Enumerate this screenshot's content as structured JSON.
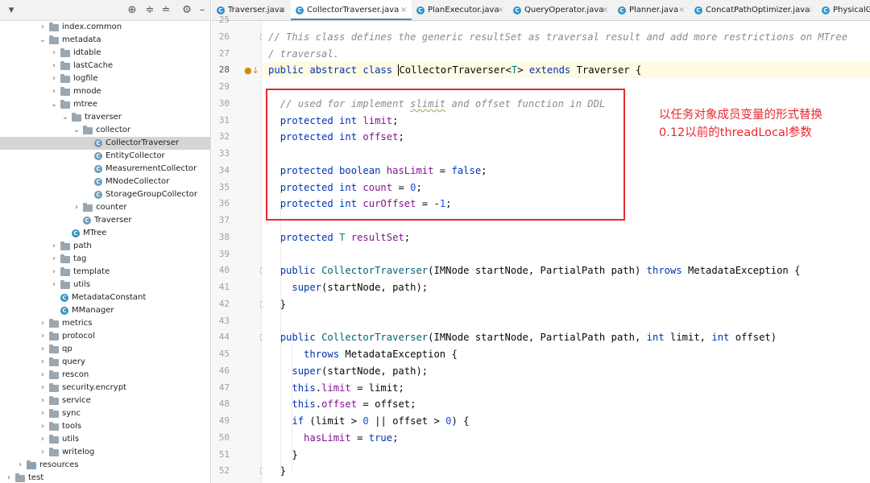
{
  "tree": {
    "header_icons": [
      "globe-icon",
      "expand-icon",
      "collapse-icon",
      "gear-icon",
      "minimize-icon"
    ],
    "rows": [
      {
        "label": "index.common",
        "indent": 3,
        "kind": "folder",
        "expanded": false
      },
      {
        "label": "metadata",
        "indent": 3,
        "kind": "folder",
        "expanded": true
      },
      {
        "label": "idtable",
        "indent": 4,
        "kind": "folder",
        "expanded": false
      },
      {
        "label": "lastCache",
        "indent": 4,
        "kind": "folder",
        "expanded": false
      },
      {
        "label": "logfile",
        "indent": 4,
        "kind": "folder",
        "expanded": false
      },
      {
        "label": "mnode",
        "indent": 4,
        "kind": "folder",
        "expanded": false
      },
      {
        "label": "mtree",
        "indent": 4,
        "kind": "folder",
        "expanded": true
      },
      {
        "label": "traverser",
        "indent": 5,
        "kind": "folder",
        "expanded": true
      },
      {
        "label": "collector",
        "indent": 6,
        "kind": "folder",
        "expanded": true
      },
      {
        "label": "CollectorTraverser",
        "indent": 7,
        "kind": "abstract-class",
        "selected": true
      },
      {
        "label": "EntityCollector",
        "indent": 7,
        "kind": "abstract-class"
      },
      {
        "label": "MeasurementCollector",
        "indent": 7,
        "kind": "abstract-class"
      },
      {
        "label": "MNodeCollector",
        "indent": 7,
        "kind": "abstract-class"
      },
      {
        "label": "StorageGroupCollector",
        "indent": 7,
        "kind": "abstract-class"
      },
      {
        "label": "counter",
        "indent": 6,
        "kind": "folder",
        "expanded": false
      },
      {
        "label": "Traverser",
        "indent": 6,
        "kind": "abstract-class"
      },
      {
        "label": "MTree",
        "indent": 5,
        "kind": "class"
      },
      {
        "label": "path",
        "indent": 4,
        "kind": "folder",
        "expanded": false
      },
      {
        "label": "tag",
        "indent": 4,
        "kind": "folder",
        "expanded": false
      },
      {
        "label": "template",
        "indent": 4,
        "kind": "folder",
        "expanded": false
      },
      {
        "label": "utils",
        "indent": 4,
        "kind": "folder",
        "expanded": false
      },
      {
        "label": "MetadataConstant",
        "indent": 4,
        "kind": "class"
      },
      {
        "label": "MManager",
        "indent": 4,
        "kind": "class"
      },
      {
        "label": "metrics",
        "indent": 3,
        "kind": "folder",
        "expanded": false
      },
      {
        "label": "protocol",
        "indent": 3,
        "kind": "folder",
        "expanded": false
      },
      {
        "label": "qp",
        "indent": 3,
        "kind": "folder",
        "expanded": false
      },
      {
        "label": "query",
        "indent": 3,
        "kind": "folder",
        "expanded": false
      },
      {
        "label": "rescon",
        "indent": 3,
        "kind": "folder",
        "expanded": false
      },
      {
        "label": "security.encrypt",
        "indent": 3,
        "kind": "folder",
        "expanded": false
      },
      {
        "label": "service",
        "indent": 3,
        "kind": "folder",
        "expanded": false
      },
      {
        "label": "sync",
        "indent": 3,
        "kind": "folder",
        "expanded": false
      },
      {
        "label": "tools",
        "indent": 3,
        "kind": "folder",
        "expanded": false
      },
      {
        "label": "utils",
        "indent": 3,
        "kind": "folder",
        "expanded": false
      },
      {
        "label": "writelog",
        "indent": 3,
        "kind": "folder",
        "expanded": false
      },
      {
        "label": "resources",
        "indent": 1,
        "kind": "resource-folder",
        "expanded": false
      },
      {
        "label": "test",
        "indent": 0,
        "kind": "folder",
        "expanded": false
      }
    ]
  },
  "tabs": [
    {
      "label": "Traverser.java",
      "active": false
    },
    {
      "label": "CollectorTraverser.java",
      "active": true
    },
    {
      "label": "PlanExecutor.java",
      "active": false
    },
    {
      "label": "QueryOperator.java",
      "active": false
    },
    {
      "label": "Planner.java",
      "active": false
    },
    {
      "label": "ConcatPathOptimizer.java",
      "active": false
    },
    {
      "label": "PhysicalG",
      "active": false
    }
  ],
  "tab_close_glyph": "×",
  "editor": {
    "current_line": 28,
    "lines": [
      {
        "n": "25",
        "tokens": []
      },
      {
        "n": "26",
        "tokens": [
          [
            "cm",
            "// This class defines the generic resultSet as traversal result and add more restrictions on MTree"
          ]
        ]
      },
      {
        "n": "27",
        "tokens": [
          [
            "cm",
            "/ traversal."
          ]
        ]
      },
      {
        "n": "28",
        "tokens": [
          [
            "kw",
            "public abstract class "
          ],
          [
            "caret",
            ""
          ],
          [
            "",
            "CollectorTraverser<"
          ],
          [
            "typ",
            "T"
          ],
          [
            "",
            "> "
          ],
          [
            "kw",
            "extends "
          ],
          [
            "",
            "Traverser {"
          ]
        ]
      },
      {
        "n": "29",
        "tokens": []
      },
      {
        "n": "30",
        "tokens": [
          [
            "",
            "  "
          ],
          [
            "cm",
            "// used for implement "
          ],
          [
            "cm sq",
            "slimit"
          ],
          [
            "cm",
            " and offset function in DDL"
          ]
        ]
      },
      {
        "n": "31",
        "tokens": [
          [
            "",
            "  "
          ],
          [
            "kw",
            "protected int "
          ],
          [
            "fld",
            "limit"
          ],
          [
            "",
            ";"
          ]
        ]
      },
      {
        "n": "32",
        "tokens": [
          [
            "",
            "  "
          ],
          [
            "kw",
            "protected int "
          ],
          [
            "fld",
            "offset"
          ],
          [
            "",
            ";"
          ]
        ]
      },
      {
        "n": "33",
        "tokens": []
      },
      {
        "n": "34",
        "tokens": [
          [
            "",
            "  "
          ],
          [
            "kw",
            "protected boolean "
          ],
          [
            "fld",
            "hasLimit"
          ],
          [
            "",
            " = "
          ],
          [
            "kw",
            "false"
          ],
          [
            "",
            ";"
          ]
        ]
      },
      {
        "n": "35",
        "tokens": [
          [
            "",
            "  "
          ],
          [
            "kw",
            "protected int "
          ],
          [
            "fld",
            "count"
          ],
          [
            "",
            " = "
          ],
          [
            "num",
            "0"
          ],
          [
            "",
            ";"
          ]
        ]
      },
      {
        "n": "36",
        "tokens": [
          [
            "",
            "  "
          ],
          [
            "kw",
            "protected int "
          ],
          [
            "fld",
            "curOffset"
          ],
          [
            "",
            " = -"
          ],
          [
            "num",
            "1"
          ],
          [
            "",
            ";"
          ]
        ]
      },
      {
        "n": "37",
        "tokens": []
      },
      {
        "n": "38",
        "tokens": [
          [
            "",
            "  "
          ],
          [
            "kw",
            "protected "
          ],
          [
            "typ",
            "T"
          ],
          [
            "",
            " "
          ],
          [
            "fld",
            "resultSet"
          ],
          [
            "",
            ";"
          ]
        ]
      },
      {
        "n": "39",
        "tokens": []
      },
      {
        "n": "40",
        "tokens": [
          [
            "",
            "  "
          ],
          [
            "kw",
            "public "
          ],
          [
            "fn",
            "CollectorTraverser"
          ],
          [
            "",
            "(IMNode startNode, PartialPath path) "
          ],
          [
            "kw",
            "throws "
          ],
          [
            "",
            "MetadataException {"
          ]
        ]
      },
      {
        "n": "41",
        "tokens": [
          [
            "",
            "    "
          ],
          [
            "kw",
            "super"
          ],
          [
            "",
            "(startNode, path);"
          ]
        ]
      },
      {
        "n": "42",
        "tokens": [
          [
            "",
            "  }"
          ]
        ]
      },
      {
        "n": "43",
        "tokens": []
      },
      {
        "n": "44",
        "tokens": [
          [
            "",
            "  "
          ],
          [
            "kw",
            "public "
          ],
          [
            "fn",
            "CollectorTraverser"
          ],
          [
            "",
            "(IMNode startNode, PartialPath path, "
          ],
          [
            "kw",
            "int "
          ],
          [
            "",
            "limit, "
          ],
          [
            "kw",
            "int "
          ],
          [
            "",
            "offset)"
          ]
        ]
      },
      {
        "n": "45",
        "tokens": [
          [
            "",
            "      "
          ],
          [
            "kw",
            "throws "
          ],
          [
            "",
            "MetadataException {"
          ]
        ]
      },
      {
        "n": "46",
        "tokens": [
          [
            "",
            "    "
          ],
          [
            "kw",
            "super"
          ],
          [
            "",
            "(startNode, path);"
          ]
        ]
      },
      {
        "n": "47",
        "tokens": [
          [
            "",
            "    "
          ],
          [
            "kw",
            "this"
          ],
          [
            "",
            "."
          ],
          [
            "fld",
            "limit"
          ],
          [
            "",
            " = limit;"
          ]
        ]
      },
      {
        "n": "48",
        "tokens": [
          [
            "",
            "    "
          ],
          [
            "kw",
            "this"
          ],
          [
            "",
            "."
          ],
          [
            "fld",
            "offset"
          ],
          [
            "",
            " = offset;"
          ]
        ]
      },
      {
        "n": "49",
        "tokens": [
          [
            "",
            "    "
          ],
          [
            "kw",
            "if "
          ],
          [
            "",
            "(limit > "
          ],
          [
            "num",
            "0"
          ],
          [
            "",
            " || offset > "
          ],
          [
            "num",
            "0"
          ],
          [
            "",
            ") {"
          ]
        ]
      },
      {
        "n": "50",
        "tokens": [
          [
            "",
            "      "
          ],
          [
            "fld",
            "hasLimit"
          ],
          [
            "",
            " = "
          ],
          [
            "kw",
            "true"
          ],
          [
            "",
            ";"
          ]
        ]
      },
      {
        "n": "51",
        "tokens": [
          [
            "",
            "    }"
          ]
        ]
      },
      {
        "n": "52",
        "tokens": [
          [
            "",
            "  }"
          ]
        ]
      }
    ]
  },
  "annotation": {
    "line1": "以任务对象成员变量的形式替换",
    "line2": "0.12以前的threadLocal参数",
    "color": "#e8282e"
  }
}
